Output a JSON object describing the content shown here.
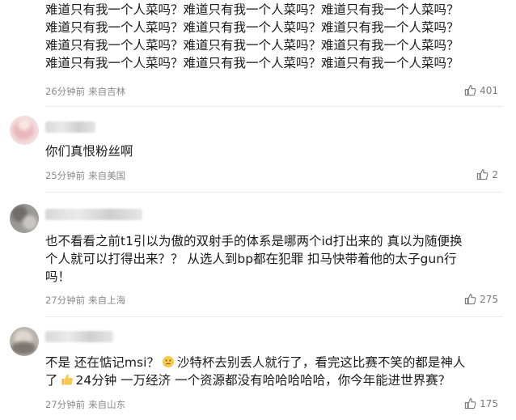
{
  "comments": [
    {
      "username": "",
      "lines": [
        "难道只有我一个人菜吗？难道只有我一个人菜吗？难道只有我一个人菜吗？",
        "难道只有我一个人菜吗？难道只有我一个人菜吗？难道只有我一个人菜吗？",
        "难道只有我一个人菜吗？难道只有我一个人菜吗？难道只有我一个人菜吗？",
        "难道只有我一个人菜吗？难道只有我一个人菜吗？难道只有我一个人菜吗？"
      ],
      "time": "26分钟前",
      "location": "来自吉林",
      "likes": "401"
    },
    {
      "username": "",
      "lines": [
        "你们真恨粉丝啊"
      ],
      "time": "25分钟前",
      "location": "来自美国",
      "likes": "2"
    },
    {
      "username": "",
      "lines": [
        "也不看看之前t1引以为傲的双射手的体系是哪两个id打出来的 真以为随便换",
        "个人就可以打得出来？？ 从选人到bp都在犯罪 扣马快带着他的太子gun行",
        "吗！"
      ],
      "time": "27分钟前",
      "location": "来自上海",
      "likes": "275"
    },
    {
      "username": "",
      "line1_a": "不是 还在惦记msi？",
      "line1_b": "沙特杯去别丢人就行了，看完这比赛不笑的都是神人",
      "line2_a": "了",
      "line2_b": "24分钟 一万经济 一个资源都没有哈哈哈哈哈，你今年能进世界赛？",
      "time": "27分钟前",
      "location": "来自山东",
      "likes": "175",
      "emoji1": "thinking-face-emoji",
      "emoji2": "thumbs-up-emoji"
    }
  ],
  "colors": {
    "text": "#1a1a1a",
    "meta": "#8a8a8a",
    "divider": "#ececec"
  },
  "icons": {
    "like": "thumbs-up-icon"
  }
}
